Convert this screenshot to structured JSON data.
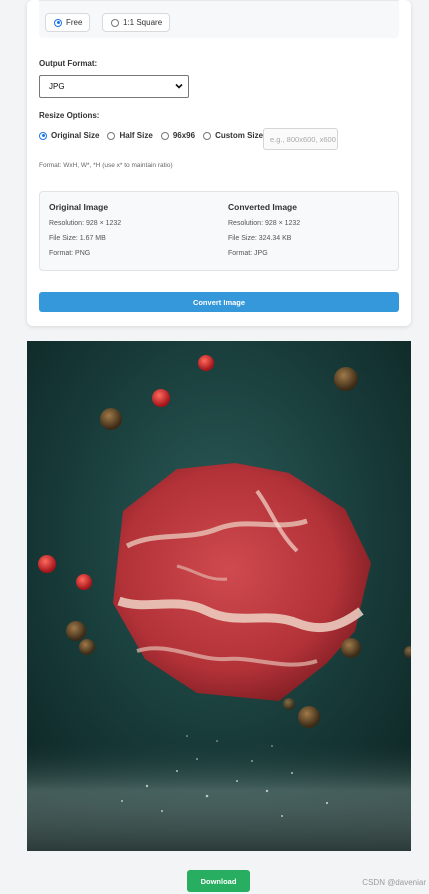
{
  "aspect_ratio": {
    "options": [
      {
        "label": "Free",
        "selected": true
      },
      {
        "label": "1:1 Square",
        "selected": false
      }
    ]
  },
  "output_format": {
    "label": "Output Format:",
    "selected": "JPG"
  },
  "resize": {
    "label": "Resize Options:",
    "options": [
      {
        "label": "Original Size",
        "selected": true
      },
      {
        "label": "Half Size",
        "selected": false
      },
      {
        "label": "96x96",
        "selected": false
      },
      {
        "label": "Custom Size",
        "selected": false
      }
    ],
    "custom_placeholder": "e.g., 800x600, x600",
    "hint": "Format: WxH, W*, *H (use x* to maintain ratio)"
  },
  "original": {
    "title": "Original Image",
    "resolution": "Resolution: 928 × 1232",
    "file_size": "File Size: 1.67 MB",
    "format": "Format: PNG"
  },
  "converted": {
    "title": "Converted Image",
    "resolution": "Resolution: 928 × 1232",
    "file_size": "File Size: 324.34 KB",
    "format": "Format: JPG"
  },
  "convert_button": "Convert Image",
  "download_button": "Download",
  "watermark": "CSDN @daveniar",
  "colors": {
    "primary_blue": "#3498db",
    "download_green": "#27ae60",
    "photo_background": "#17393a",
    "meat_red": "#b8363c"
  }
}
